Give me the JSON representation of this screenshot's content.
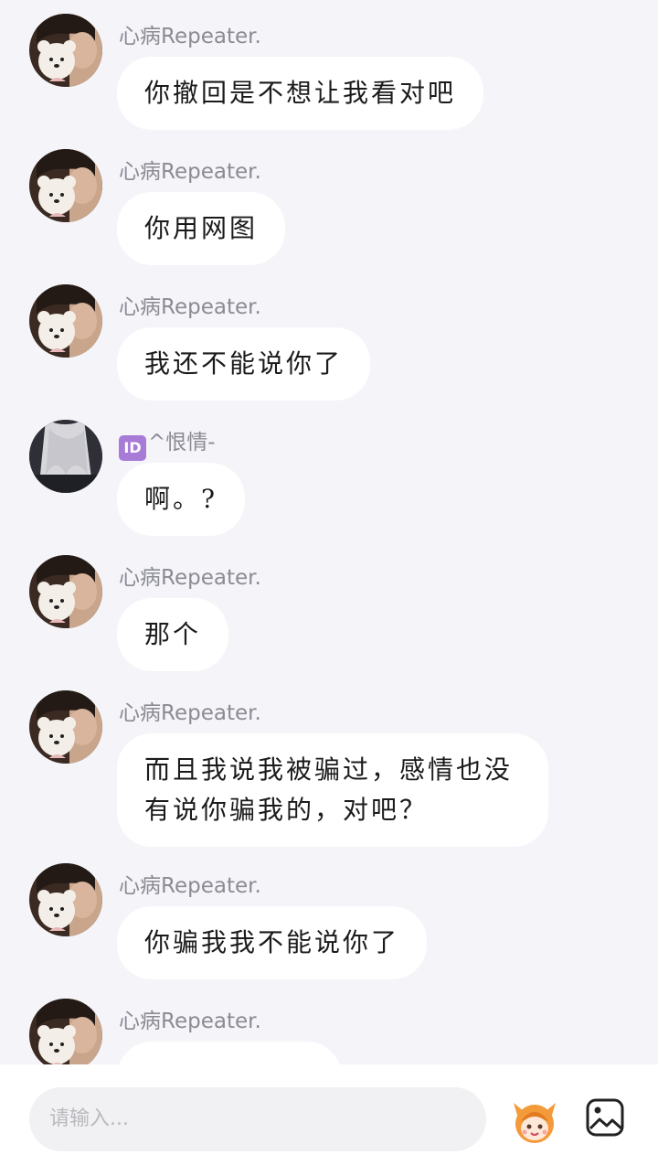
{
  "messages": [
    {
      "sender": "心病Repeater.",
      "text": "你撤回是不想让我看对吧",
      "avatar": "boy-with-plush"
    },
    {
      "sender": "心病Repeater.",
      "text": "你用网图",
      "avatar": "boy-with-plush"
    },
    {
      "sender": "心病Repeater.",
      "text": "我还不能说你了",
      "avatar": "boy-with-plush"
    },
    {
      "sender": "^恨情-",
      "badge": "ID",
      "text": "啊。?",
      "avatar": "silver-hair-girl"
    },
    {
      "sender": "心病Repeater.",
      "text": "那个",
      "avatar": "boy-with-plush"
    },
    {
      "sender": "心病Repeater.",
      "text": "而且我说我被骗过，感情也没有说你骗我的，对吧？",
      "avatar": "boy-with-plush"
    },
    {
      "sender": "心病Repeater.",
      "text": "你骗我我不能说你了",
      "avatar": "boy-with-plush"
    },
    {
      "sender": "心病Repeater.",
      "text": "",
      "avatar": "boy-with-plush"
    }
  ],
  "input": {
    "placeholder": "请输入..."
  },
  "icons": {
    "emoji": "mascot-emoji-icon",
    "image": "image-icon"
  },
  "colors": {
    "background": "#f4f4f9",
    "bubble": "#ffffff",
    "sender_name": "#8b8b93",
    "id_badge": "#a77bd6"
  }
}
